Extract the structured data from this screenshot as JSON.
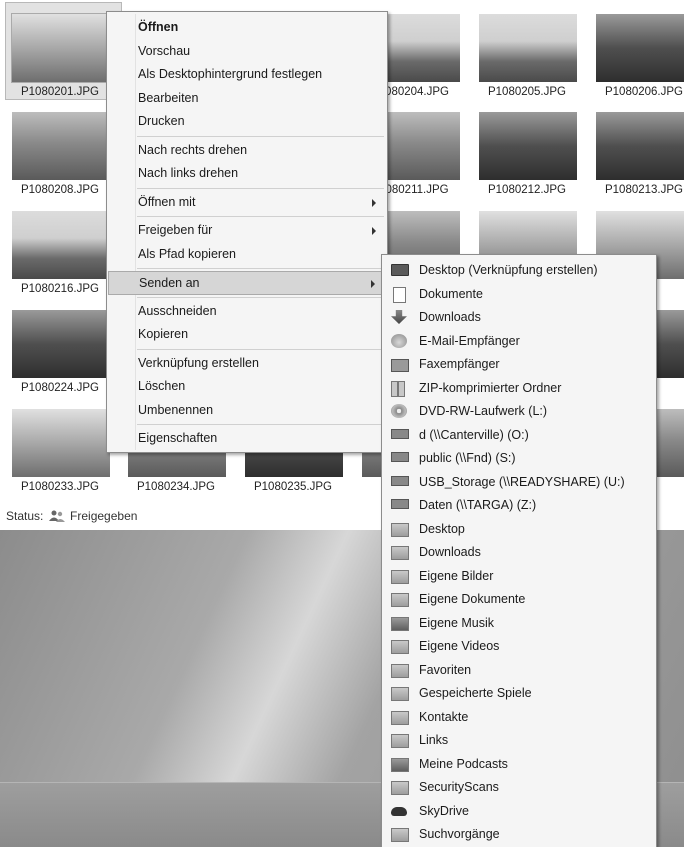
{
  "thumbnails": [
    {
      "label": "P1080201.JPG",
      "tone": "light"
    },
    {
      "label": "",
      "tone": "dark"
    },
    {
      "label": "",
      "tone": "dark"
    },
    {
      "label": "P1080204.JPG",
      "tone": "sky"
    },
    {
      "label": "P1080205.JPG",
      "tone": "sky"
    },
    {
      "label": "P1080206.JPG",
      "tone": "dark"
    },
    {
      "label": "P1080208.JPG",
      "tone": ""
    },
    {
      "label": "",
      "tone": ""
    },
    {
      "label": "",
      "tone": ""
    },
    {
      "label": "P1080211.JPG",
      "tone": ""
    },
    {
      "label": "P1080212.JPG",
      "tone": "dark"
    },
    {
      "label": "P1080213.JPG",
      "tone": "dark"
    },
    {
      "label": "P1080216.JPG",
      "tone": "sky"
    },
    {
      "label": "",
      "tone": ""
    },
    {
      "label": "",
      "tone": ""
    },
    {
      "label": "",
      "tone": ""
    },
    {
      "label": "",
      "tone": "light"
    },
    {
      "label": "JPG",
      "tone": "light"
    },
    {
      "label": "P1080224.JPG",
      "tone": "dark"
    },
    {
      "label": "",
      "tone": ""
    },
    {
      "label": "",
      "tone": ""
    },
    {
      "label": "",
      "tone": ""
    },
    {
      "label": "",
      "tone": ""
    },
    {
      "label": "JPG",
      "tone": "dark"
    },
    {
      "label": "P1080233.JPG",
      "tone": "light"
    },
    {
      "label": "P1080234.JPG",
      "tone": ""
    },
    {
      "label": "P1080235.JPG",
      "tone": "dark"
    },
    {
      "label": "P1",
      "tone": ""
    },
    {
      "label": "",
      "tone": ""
    },
    {
      "label": "JPG",
      "tone": ""
    }
  ],
  "status": {
    "prefix": "Status:",
    "value": "Freigegeben"
  },
  "context_menu": {
    "items": [
      {
        "label": "Öffnen",
        "bold": true
      },
      {
        "label": "Vorschau"
      },
      {
        "label": "Als Desktophintergrund festlegen"
      },
      {
        "label": "Bearbeiten"
      },
      {
        "label": "Drucken"
      },
      {
        "sep": true
      },
      {
        "label": "Nach rechts drehen"
      },
      {
        "label": "Nach links drehen"
      },
      {
        "sep": true
      },
      {
        "label": "Öffnen mit",
        "submenu": true
      },
      {
        "sep": true
      },
      {
        "label": "Freigeben für",
        "submenu": true
      },
      {
        "label": "Als Pfad kopieren"
      },
      {
        "sep": true
      },
      {
        "label": "Senden an",
        "submenu": true,
        "highlighted": true
      },
      {
        "sep": true
      },
      {
        "label": "Ausschneiden"
      },
      {
        "label": "Kopieren"
      },
      {
        "sep": true
      },
      {
        "label": "Verknüpfung erstellen"
      },
      {
        "label": "Löschen"
      },
      {
        "label": "Umbenennen"
      },
      {
        "sep": true
      },
      {
        "label": "Eigenschaften"
      }
    ]
  },
  "send_to_menu": {
    "items": [
      {
        "label": "Desktop (Verknüpfung erstellen)",
        "icon": "monitor-icon"
      },
      {
        "label": "Dokumente",
        "icon": "document-icon"
      },
      {
        "label": "Downloads",
        "icon": "download-icon"
      },
      {
        "label": "E-Mail-Empfänger",
        "icon": "mail-icon"
      },
      {
        "label": "Faxempfänger",
        "icon": "fax-icon"
      },
      {
        "label": "ZIP-komprimierter Ordner",
        "icon": "zip-folder-icon"
      },
      {
        "label": "DVD-RW-Laufwerk (L:)",
        "icon": "dvd-drive-icon"
      },
      {
        "label": "d (\\\\Canterville) (O:)",
        "icon": "network-drive-icon"
      },
      {
        "label": "public (\\\\Fnd) (S:)",
        "icon": "network-drive-icon"
      },
      {
        "label": "USB_Storage (\\\\READYSHARE) (U:)",
        "icon": "network-drive-icon"
      },
      {
        "label": "Daten (\\\\TARGA) (Z:)",
        "icon": "network-drive-icon"
      },
      {
        "label": "Desktop",
        "icon": "folder-icon"
      },
      {
        "label": "Downloads",
        "icon": "folder-icon"
      },
      {
        "label": "Eigene Bilder",
        "icon": "folder-icon"
      },
      {
        "label": "Eigene Dokumente",
        "icon": "folder-icon"
      },
      {
        "label": "Eigene Musik",
        "icon": "folder-icon"
      },
      {
        "label": "Eigene Videos",
        "icon": "folder-icon"
      },
      {
        "label": "Favoriten",
        "icon": "folder-icon"
      },
      {
        "label": "Gespeicherte Spiele",
        "icon": "folder-icon"
      },
      {
        "label": "Kontakte",
        "icon": "folder-icon"
      },
      {
        "label": "Links",
        "icon": "folder-icon"
      },
      {
        "label": "Meine Podcasts",
        "icon": "folder-icon"
      },
      {
        "label": "SecurityScans",
        "icon": "folder-icon"
      },
      {
        "label": "SkyDrive",
        "icon": "cloud-icon"
      },
      {
        "label": "Suchvorgänge",
        "icon": "folder-icon"
      }
    ]
  }
}
